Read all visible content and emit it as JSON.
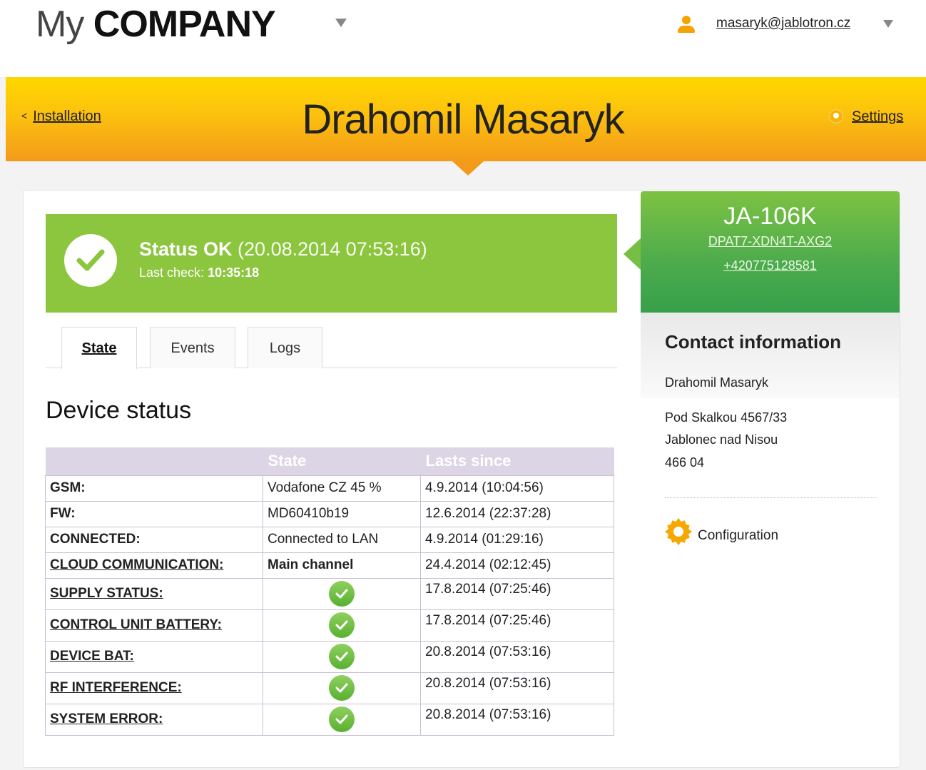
{
  "header": {
    "logo_my": "My",
    "logo_company": "COMPANY",
    "user_email": "masaryk@jablotron.cz"
  },
  "banner": {
    "back_label": "Installation",
    "title": "Drahomil Masaryk",
    "settings_label": "Settings",
    "colors": {
      "top": "#ffd700",
      "bottom": "#f39a1b"
    }
  },
  "status": {
    "label": "Status OK",
    "timestamp": "(20.08.2014 07:53:16)",
    "last_check_label": "Last check:",
    "last_check_time": "10:35:18",
    "color": "#8cc53e"
  },
  "device": {
    "model": "JA-106K",
    "code": "DPAT7-XDN4T-AXG2",
    "phone": "+420775128581"
  },
  "contact": {
    "title": "Contact information",
    "name": "Drahomil Masaryk",
    "address_line1": "Pod Skalkou 4567/33",
    "address_line2": "Jablonec nad Nisou",
    "address_line3": "466 04",
    "configuration_label": "Configuration"
  },
  "tabs": [
    {
      "label": "State",
      "active": true
    },
    {
      "label": "Events",
      "active": false
    },
    {
      "label": "Logs",
      "active": false
    }
  ],
  "device_status": {
    "title": "Device status",
    "columns": [
      "",
      "State",
      "Lasts since"
    ],
    "rows": [
      {
        "label": "GSM:",
        "state": "Vodafone CZ 45 %",
        "since": "4.9.2014 (10:04:56)"
      },
      {
        "label": "FW:",
        "state": "MD60410b19",
        "since": "12.6.2014 (22:37:28)"
      },
      {
        "label": "CONNECTED:",
        "state": "Connected to LAN",
        "since": "4.9.2014 (01:29:16)"
      },
      {
        "label": "CLOUD COMMUNICATION:",
        "state": "Main channel",
        "since": "24.4.2014 (02:12:45)"
      },
      {
        "label": "SUPPLY STATUS:",
        "state": "ok-icon",
        "since": "17.8.2014 (07:25:46)"
      },
      {
        "label": "CONTROL UNIT BATTERY:",
        "state": "ok-icon",
        "since": "17.8.2014 (07:25:46)"
      },
      {
        "label": "DEVICE BAT:",
        "state": "ok-icon",
        "since": "20.8.2014 (07:53:16)"
      },
      {
        "label": "RF INTERFERENCE:",
        "state": "ok-icon",
        "since": "20.8.2014 (07:53:16)"
      },
      {
        "label": "SYSTEM ERROR:",
        "state": "ok-icon",
        "since": "20.8.2014 (07:53:16)"
      }
    ]
  }
}
